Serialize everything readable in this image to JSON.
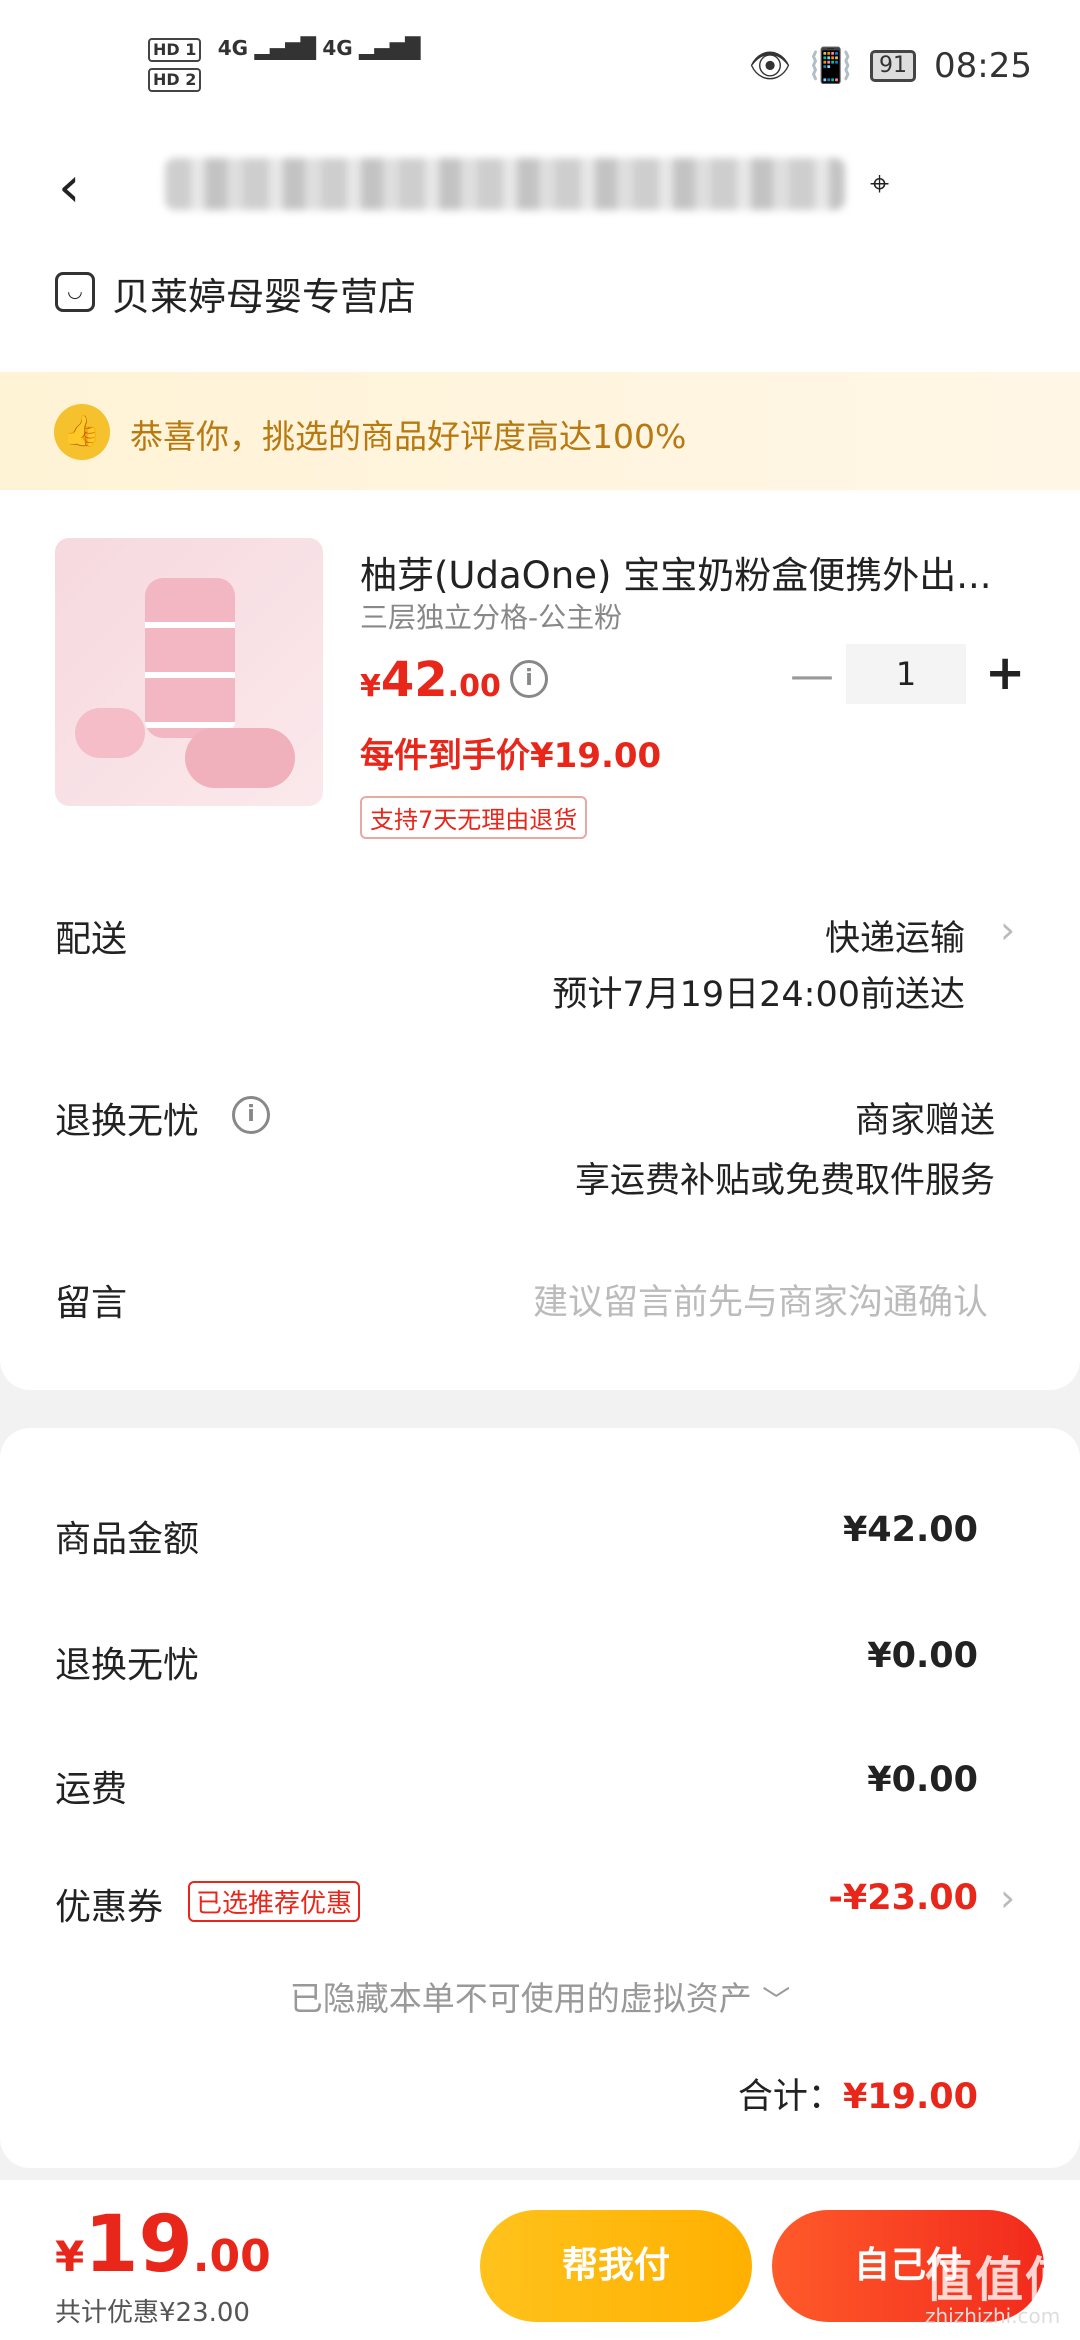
{
  "status_bar": {
    "sim1": "HD 1",
    "sim2": "HD 2",
    "signal1": "4G",
    "signal2": "4G",
    "battery": "91",
    "time": "08:25"
  },
  "header": {
    "store_name": "贝莱婷母婴专营店"
  },
  "banner": {
    "text": "恭喜你，挑选的商品好评度高达100%"
  },
  "product": {
    "title": "柚芽(UdaOne) 宝宝奶粉盒便携外出...",
    "spec": "三层独立分格-公主粉",
    "price_currency": "¥",
    "price_integer": "42",
    "price_decimal": ".00",
    "quantity": "1",
    "unit_price_text": "每件到手价¥19.00",
    "return_tag": "支持7天无理由退货"
  },
  "delivery": {
    "label": "配送",
    "method": "快递运输",
    "eta": "预计7月19日24:00前送达"
  },
  "return_service": {
    "label": "退换无忧",
    "provider": "商家赠送",
    "desc": "享运费补贴或免费取件服务"
  },
  "message": {
    "label": "留言",
    "placeholder": "建议留言前先与商家沟通确认"
  },
  "summary": {
    "goods_label": "商品金额",
    "goods_value": "¥42.00",
    "return_label": "退换无忧",
    "return_value": "¥0.00",
    "shipping_label": "运费",
    "shipping_value": "¥0.00",
    "coupon_label": "优惠券",
    "coupon_tag": "已选推荐优惠",
    "coupon_value": "-¥23.00",
    "hidden_assets": "已隐藏本单不可使用的虚拟资产",
    "total_label": "合计：",
    "total_value": "¥19.00"
  },
  "footer": {
    "currency": "¥",
    "price_integer": "19",
    "price_decimal": ".00",
    "discount_text": "共计优惠¥23.00",
    "help_pay_label": "帮我付",
    "self_pay_label": "自己付"
  },
  "watermark": {
    "text": "值值值",
    "url": "zhizhizhi.com"
  }
}
